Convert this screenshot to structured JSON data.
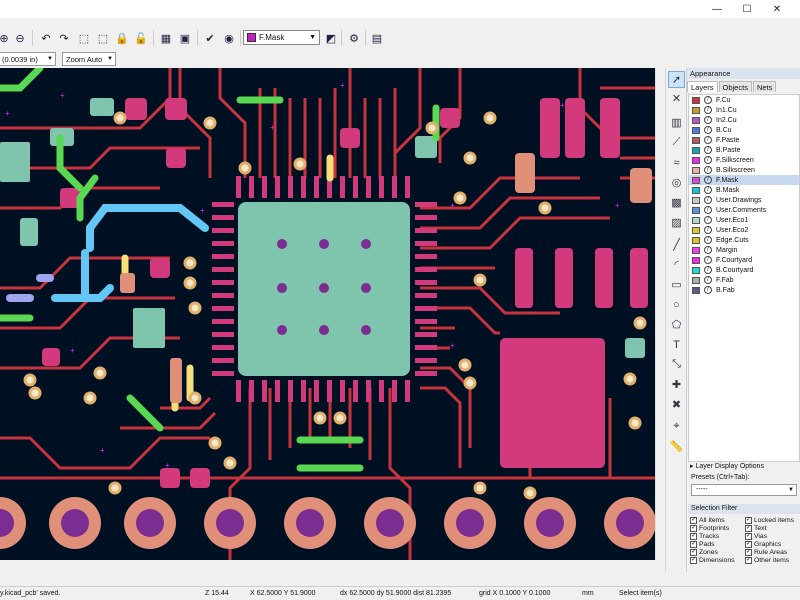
{
  "titlebar": {
    "minimize": "—",
    "maximize": "☐",
    "close": "✕"
  },
  "toolbar": {
    "active_layer": "F.Mask",
    "grid_value": "(0.0039 in)",
    "zoom_value": "Zoom Auto"
  },
  "appearance": {
    "title": "Appearance",
    "tabs": [
      "Layers",
      "Objects",
      "Nets"
    ],
    "layers": [
      {
        "name": "F.Cu",
        "color": "#c8343e"
      },
      {
        "name": "In1.Cu",
        "color": "#c4a228"
      },
      {
        "name": "In2.Cu",
        "color": "#b15cc5"
      },
      {
        "name": "B.Cu",
        "color": "#4d7ad8"
      },
      {
        "name": "F.Paste",
        "color": "#b45a5a"
      },
      {
        "name": "B.Paste",
        "color": "#14a8b4"
      },
      {
        "name": "F.Silkscreen",
        "color": "#f02bf0"
      },
      {
        "name": "B.Silkscreen",
        "color": "#e8b2a8"
      },
      {
        "name": "F.Mask",
        "color": "#d94ad9"
      },
      {
        "name": "B.Mask",
        "color": "#14c8d8"
      },
      {
        "name": "User.Drawings",
        "color": "#c8c8c8"
      },
      {
        "name": "User.Comments",
        "color": "#5995d9"
      },
      {
        "name": "User.Eco1",
        "color": "#b4dbd2"
      },
      {
        "name": "User.Eco2",
        "color": "#d7c838"
      },
      {
        "name": "Edge.Cuts",
        "color": "#d8c820"
      },
      {
        "name": "Margin",
        "color": "#f040f0"
      },
      {
        "name": "F.Courtyard",
        "color": "#f028f0"
      },
      {
        "name": "B.Courtyard",
        "color": "#22d8d8"
      },
      {
        "name": "F.Fab",
        "color": "#afafaf"
      },
      {
        "name": "B.Fab",
        "color": "#585d84"
      }
    ],
    "selected_layer": "F.Mask",
    "layer_display_options": "Layer Display Options",
    "presets_label": "Presets (Ctrl+Tab):",
    "presets_value": "-----"
  },
  "selection_filter": {
    "title": "Selection Filter",
    "items": [
      "All items",
      "Locked items",
      "Footprints",
      "Text",
      "Tracks",
      "Vias",
      "Pads",
      "Graphics",
      "Zones",
      "Rule Areas",
      "Dimensions",
      "Other items"
    ]
  },
  "status": {
    "message": "y.kicad_pcb' saved.",
    "z": "Z 15.44",
    "xy": "X 62.5000  Y 51.9000",
    "dxy": "dx 62.5000  dy 51.9000  dist 81.2395",
    "grid": "grid X 0.1000  Y 0.1000",
    "units": "mm",
    "tool": "Select item(s)"
  },
  "colors": {
    "board_bg": "#001023",
    "fcu": "#c8343e",
    "pad": "#d23a7b",
    "ep": "#7fc4ad",
    "via_ring": "#e0b06c",
    "silk_green": "#5ad852",
    "blue_track": "#62c7f5",
    "salmon": "#e09078"
  }
}
